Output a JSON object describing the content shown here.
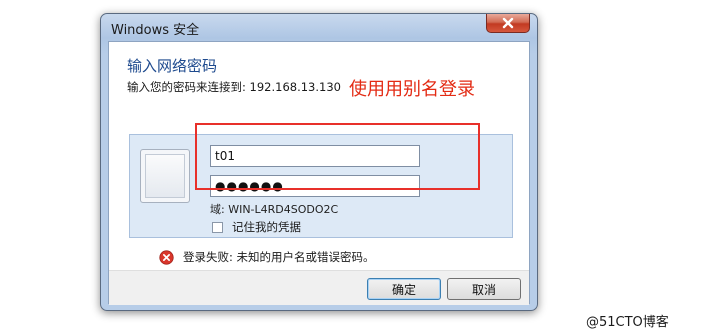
{
  "window": {
    "title": "Windows 安全"
  },
  "dialog": {
    "heading": "输入网络密码",
    "subtext": "输入您的密码来连接到: 192.168.13.130",
    "annotation": "使用用别名登录"
  },
  "credentials": {
    "username": "t01",
    "password_mask": "●●●●●●",
    "domain": "域: WIN-L4RD4SODO2C",
    "remember_label": "记住我的凭据",
    "remember_checked": false
  },
  "error": {
    "message": "登录失败: 未知的用户名或错误密码。"
  },
  "buttons": {
    "ok": "确定",
    "cancel": "取消"
  },
  "watermark": "@51CTO博客",
  "colors": {
    "accent_heading": "#1e4a8e",
    "annotation_red": "#e32b14",
    "highlight_border": "#e8302a"
  }
}
